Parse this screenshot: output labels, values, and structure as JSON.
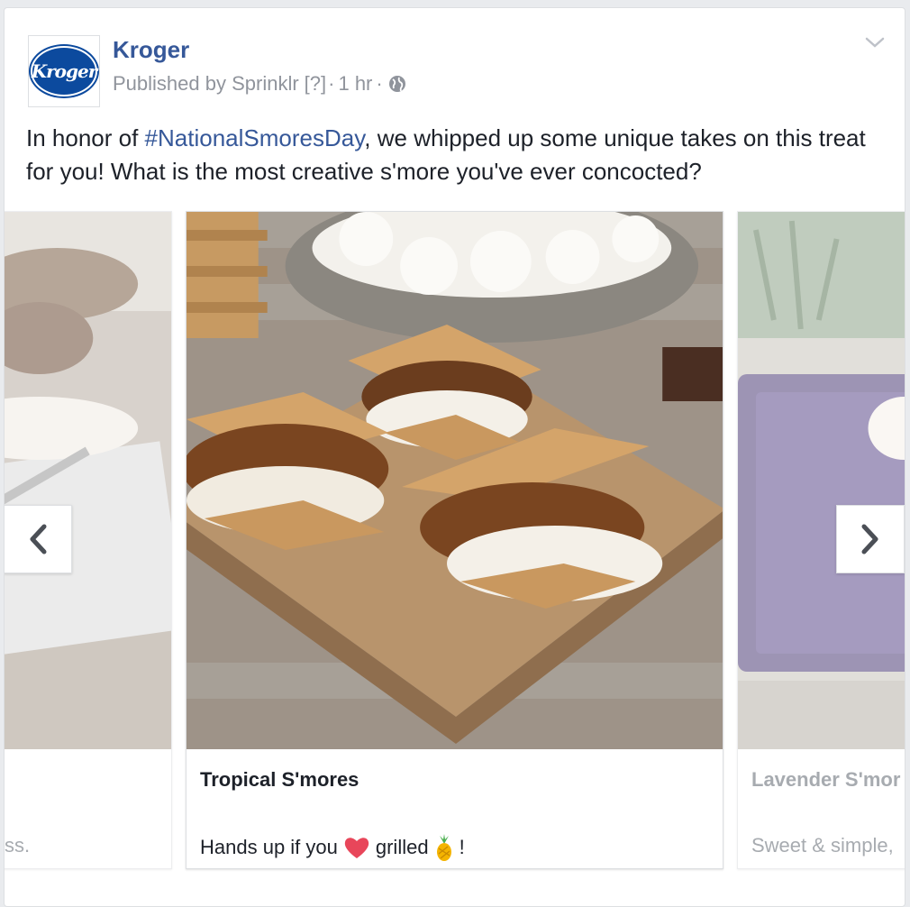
{
  "post": {
    "page_name": "Kroger",
    "logo_text": "Kroger",
    "published_by": "Published by Sprinklr",
    "help_marker": "[?]",
    "separator": "·",
    "timestamp": "1 hr",
    "privacy_icon": "globe-icon",
    "options_icon": "chevron-down-icon",
    "text_before": "In honor of ",
    "hashtag": "#NationalSmoresDay",
    "text_after": ", we whipped up some unique takes on this treat for you! What is the most creative s'more you've ever concocted?"
  },
  "carousel": {
    "prev_icon": "chevron-left-icon",
    "next_icon": "chevron-right-icon",
    "items": [
      {
        "title": "",
        "desc_tail": "ss."
      },
      {
        "title": "Tropical S'mores",
        "desc_part1": "Hands up if you",
        "desc_part2": "grilled",
        "desc_part3": "!",
        "emoji1": "heart-emoji",
        "emoji2": "pineapple-emoji"
      },
      {
        "title": "Lavender S'mor",
        "desc": "Sweet & simple,"
      }
    ]
  },
  "colors": {
    "link": "#365899",
    "meta": "#90949c",
    "text": "#1d2129",
    "logo_blue": "#0c4a9e"
  }
}
